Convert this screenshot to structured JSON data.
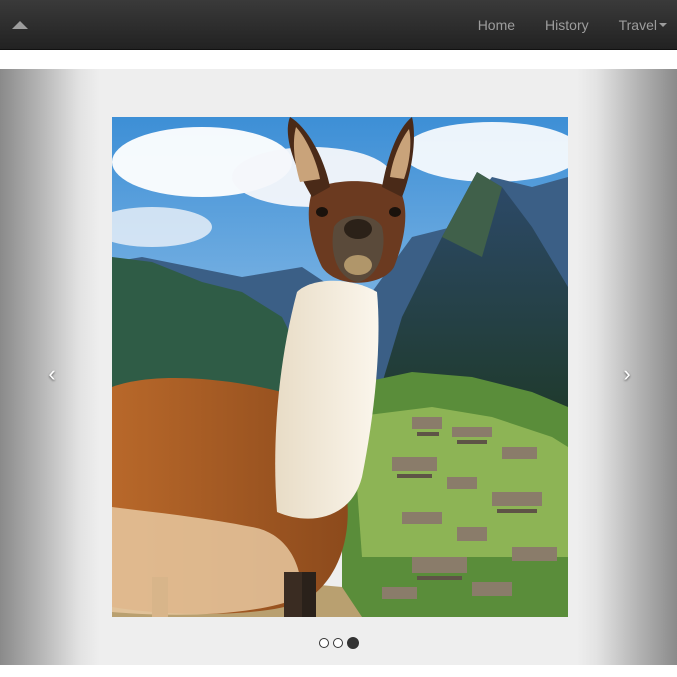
{
  "navbar": {
    "toggle_icon": "triangle-up-icon",
    "links": [
      {
        "label": "Home"
      },
      {
        "label": "History"
      },
      {
        "label": "Travel",
        "has_dropdown": true
      }
    ]
  },
  "carousel": {
    "prev_control": "‹",
    "next_control": "›",
    "slide": {
      "alt": "Llama at Machu Picchu"
    },
    "indicators": {
      "count": 3,
      "active_index": 2
    }
  },
  "colors": {
    "navbar_bg": "#2b2b2b",
    "nav_text": "#9d9d9d",
    "carousel_bg": "#eeeeee"
  }
}
